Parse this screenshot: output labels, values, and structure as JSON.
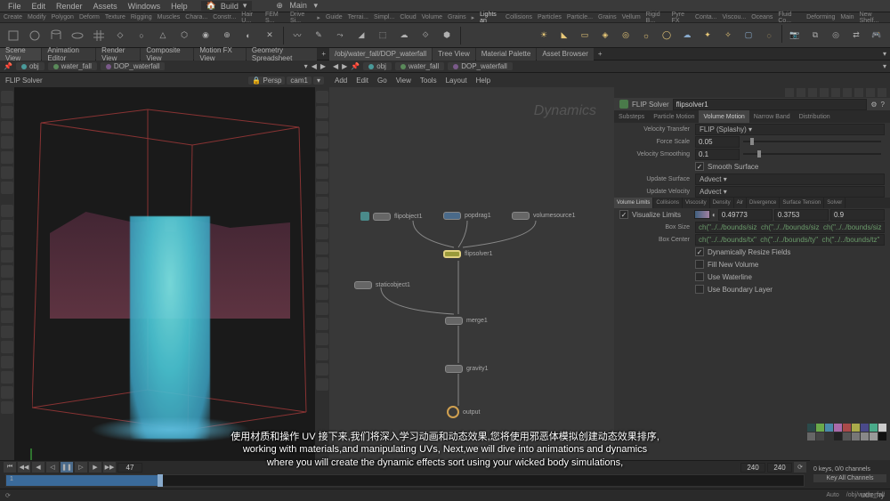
{
  "menubar": {
    "items": [
      "File",
      "Edit",
      "Render",
      "Assets",
      "Windows",
      "Help"
    ],
    "build": "Build",
    "main": "Main"
  },
  "shelftabs": {
    "row1": [
      "Create",
      "Modify",
      "Polygon",
      "Deform",
      "Texture",
      "Rigging",
      "Muscles",
      "Chara...",
      "Constr...",
      "Hair U...",
      "FEM S...",
      "Drive Si..."
    ],
    "row2": [
      "Guide",
      "Terrai...",
      "Simpl...",
      "Cloud",
      "Volume",
      "Grains",
      "Lights an",
      "Collisions",
      "Particles",
      "Particle...",
      "Grains",
      "Vellum",
      "Rigid B...",
      "Pyre FX",
      "Conta...",
      "Viscou...",
      "Oceans",
      "Fluid Co...",
      "Deforming"
    ],
    "right": [
      "Main",
      "New Shelf..."
    ]
  },
  "shelf_tools_right": [
    "Point Light",
    "Spot Light",
    "Area Light",
    "Geo Light",
    "Volume Light",
    "Distant Light",
    "Env Light",
    "Sky Light",
    "GI Light",
    "Caustic Light",
    "Portal Light",
    "Ambient",
    "Camera",
    "Stereo Cam",
    "VR Camera",
    "Switcher",
    "Gamepad Camera"
  ],
  "pane_tabs_left": [
    "Scene View",
    "Animation Editor",
    "Render View",
    "Composite View",
    "Motion FX View",
    "Geometry Spreadsheet"
  ],
  "pane_tabs_right": [
    " /obj/water_fall/DOP_waterfall ",
    "Tree View",
    "Material Palette",
    "Asset Browser"
  ],
  "path_left": {
    "crumbs": [
      "obj",
      "water_fall",
      "DOP_waterfall"
    ]
  },
  "path_right": {
    "crumbs": [
      "obj",
      "water_fall",
      "DOP_waterfall"
    ]
  },
  "viewport": {
    "title": "FLIP Solver",
    "persp": "Persp",
    "cam": "cam1"
  },
  "network": {
    "menu": [
      "Add",
      "Edit",
      "Go",
      "View",
      "Tools",
      "Layout",
      "Help"
    ],
    "label": "Dynamics",
    "nodes": {
      "flipobject": "flipobject1",
      "popdrag": "popdrag1",
      "volumesource": "volumesource1",
      "flipsolver": "flipsolver1",
      "staticobject": "staticobject1",
      "merge": "merge1",
      "gravity": "gravity1",
      "output": "output"
    }
  },
  "params": {
    "title": "FLIP Solver",
    "node": "flipsolver1",
    "tabs": [
      "Substeps",
      "Particle Motion",
      "Volume Motion",
      "Narrow Band",
      "Distribution"
    ],
    "velocity_transfer_label": "Velocity Transfer",
    "velocity_transfer": "FLIP (Splashy)",
    "force_scale_label": "Force Scale",
    "force_scale": "0.05",
    "velocity_smoothing_label": "Velocity Smoothing",
    "velocity_smoothing": "0.1",
    "smooth_surface": "Smooth Surface",
    "update_surface_label": "Update Surface",
    "update_surface": "Advect",
    "update_velocity_label": "Update Velocity",
    "update_velocity": "Advect",
    "subtabs": [
      "Volume Limits",
      "Collisions",
      "Viscosity",
      "Density",
      "Air",
      "Divergence",
      "Surface Tension",
      "Solver"
    ],
    "visualize_limits": "Visualize Limits",
    "vis_vals": [
      "0.49773",
      "0.3753",
      "0.9"
    ],
    "box_size_label": "Box Size",
    "box_size": "ch(\"../../bounds/siz  ch(\"../../bounds/siz  ch(\"../../bounds/siz",
    "box_center_label": "Box Center",
    "box_center": "ch(\"../../bounds/tx\"  ch(\"../../bounds/ty\"  ch(\"../../bounds/tz\"",
    "dyn_resize": "Dynamically Resize Fields",
    "fill_vol": "Fill New Volume",
    "waterline": "Use Waterline",
    "boundary": "Use Boundary Layer"
  },
  "timeline": {
    "frame": "47",
    "start": "1",
    "end": "240",
    "end2": "240"
  },
  "bottom_right": {
    "keys": "0 keys, 0/0 channels",
    "btn": "Key All Channels"
  },
  "subtitle": {
    "line1": "使用材质和操作 UV 接下来,我们将深入学习动画和动态效果,您将使用邪恶体模拟创建动态效果排序,",
    "line2": "working with materials,and manipulating UVs, Next,we will dive into animations and dynamics",
    "line3": "where you will create the dynamic effects sort using your wicked body simulations,"
  },
  "status": {
    "path": "/obj/water_fall",
    "auto": "Auto"
  },
  "brand": "udemy"
}
